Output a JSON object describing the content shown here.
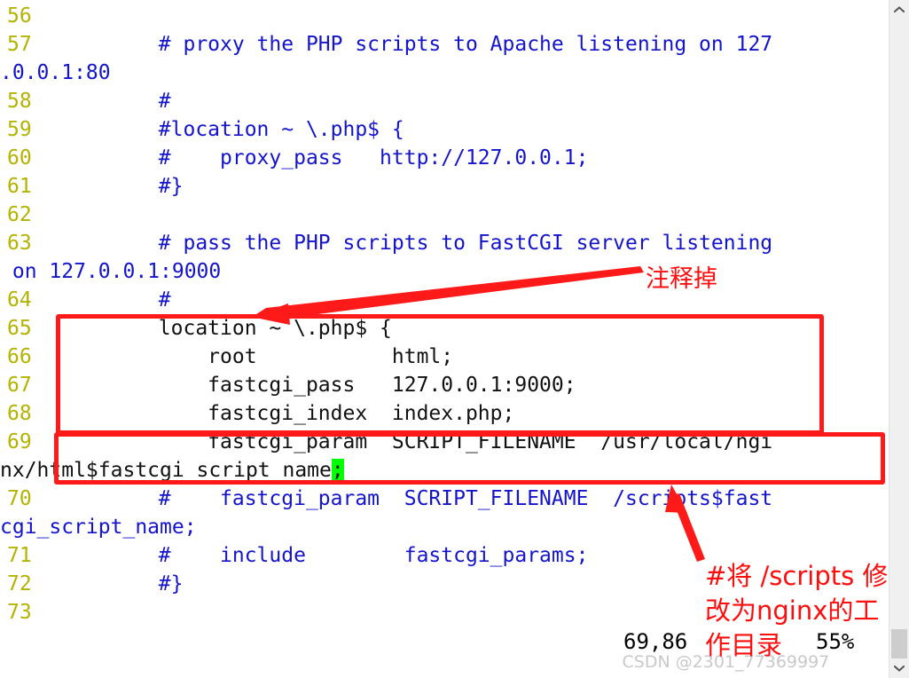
{
  "editor": {
    "lines": [
      {
        "num": "56",
        "segments": []
      },
      {
        "num": "57",
        "segments": [
          {
            "text": "        # proxy the PHP scripts to Apache listening on 127",
            "style": "comment"
          }
        ],
        "wrap": [
          {
            "text": ".0.0.1:80",
            "style": "comment"
          }
        ]
      },
      {
        "num": "58",
        "segments": [
          {
            "text": "        #",
            "style": "comment"
          }
        ]
      },
      {
        "num": "59",
        "segments": [
          {
            "text": "        #location ~ \\.php$ {",
            "style": "comment"
          }
        ]
      },
      {
        "num": "60",
        "segments": [
          {
            "text": "        #    proxy_pass   http://127.0.0.1;",
            "style": "comment"
          }
        ]
      },
      {
        "num": "61",
        "segments": [
          {
            "text": "        #}",
            "style": "comment"
          }
        ]
      },
      {
        "num": "62",
        "segments": []
      },
      {
        "num": "63",
        "segments": [
          {
            "text": "        # pass the PHP scripts to FastCGI server listening",
            "style": "comment"
          }
        ],
        "wrap": [
          {
            "text": " on 127.0.0.1:9000",
            "style": "comment"
          }
        ]
      },
      {
        "num": "64",
        "segments": [
          {
            "text": "        #",
            "style": "comment"
          }
        ]
      },
      {
        "num": "65",
        "segments": [
          {
            "text": "        location ~ \\.php$ {",
            "style": "normal"
          }
        ]
      },
      {
        "num": "66",
        "segments": [
          {
            "text": "            root           html;",
            "style": "normal"
          }
        ]
      },
      {
        "num": "67",
        "segments": [
          {
            "text": "            fastcgi_pass   127.0.0.1:9000;",
            "style": "normal"
          }
        ]
      },
      {
        "num": "68",
        "segments": [
          {
            "text": "            fastcgi_index  index.php;",
            "style": "normal"
          }
        ]
      },
      {
        "num": "69",
        "segments": [
          {
            "text": "            fastcgi_param  SCRIPT_FILENAME  /usr/local/ngi",
            "style": "normal"
          }
        ],
        "wrap": [
          {
            "text": "nx/html$fastcgi_script_name",
            "style": "normal"
          },
          {
            "text": ";",
            "style": "cursor"
          }
        ]
      },
      {
        "num": "70",
        "segments": [
          {
            "text": "        #    fastcgi_param  SCRIPT_FILENAME  /scripts$fast",
            "style": "comment"
          }
        ],
        "wrap": [
          {
            "text": "cgi_script_name;",
            "style": "comment"
          }
        ]
      },
      {
        "num": "71",
        "segments": [
          {
            "text": "        #    include        fastcgi_params;",
            "style": "comment"
          }
        ]
      },
      {
        "num": "72",
        "segments": [
          {
            "text": "        #}",
            "style": "comment"
          }
        ]
      },
      {
        "num": "73",
        "segments": []
      }
    ]
  },
  "annotations": {
    "top_note": "注释掉",
    "bottom_note_line1": "#将 /scripts 修",
    "bottom_note_line2": "改为nginx的工",
    "bottom_note_line3": "作目录",
    "box_color": "#ff1a1a",
    "arrow_color": "#ff1a1a"
  },
  "status": {
    "position": "69,86",
    "percent": "55%"
  },
  "watermark": {
    "text": "CSDN @2301_77369997"
  },
  "scrollbar": {
    "up_arrow_icon": "chevron-up-icon",
    "down_arrow_icon": "chevron-down-icon"
  }
}
